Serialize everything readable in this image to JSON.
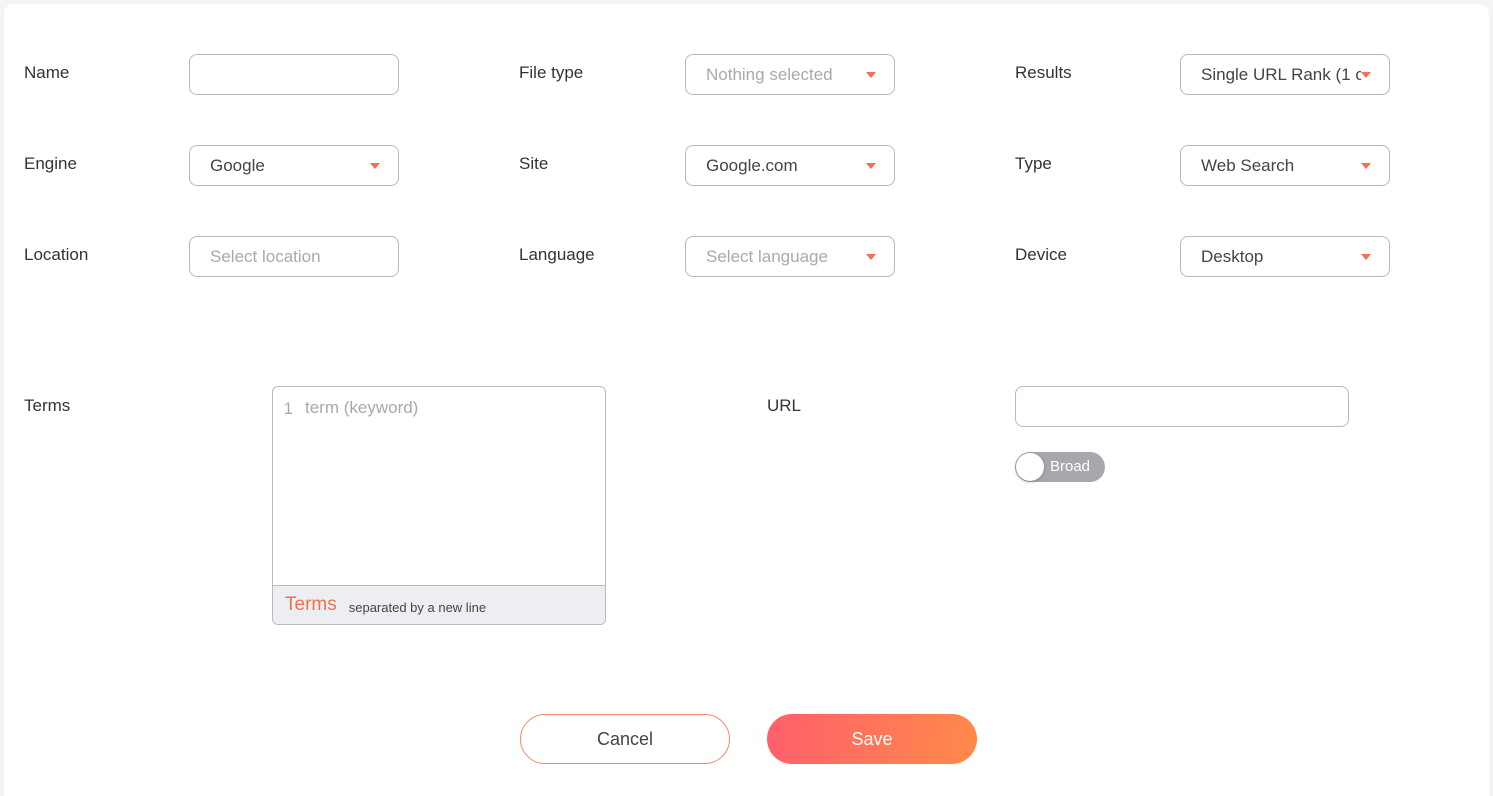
{
  "form": {
    "name": {
      "label": "Name",
      "value": ""
    },
    "file_type": {
      "label": "File type",
      "value": "Nothing selected"
    },
    "results": {
      "label": "Results",
      "value": "Single URL Rank (1 c"
    },
    "engine": {
      "label": "Engine",
      "value": "Google"
    },
    "site": {
      "label": "Site",
      "value": "Google.com"
    },
    "type": {
      "label": "Type",
      "value": "Web Search"
    },
    "location": {
      "label": "Location",
      "placeholder": "Select location"
    },
    "language": {
      "label": "Language",
      "value": "Select language"
    },
    "device": {
      "label": "Device",
      "value": "Desktop"
    },
    "terms": {
      "label": "Terms",
      "line_number": "1",
      "placeholder": "term (keyword)",
      "footer_title": "Terms",
      "footer_hint": "separated by a new line"
    },
    "url": {
      "label": "URL",
      "value": ""
    },
    "broad_toggle": {
      "label": "Broad"
    }
  },
  "actions": {
    "cancel_label": "Cancel",
    "save_label": "Save"
  },
  "colors": {
    "accent": "#f2704d",
    "toggle_off": "#a7a8ae",
    "save_gradient_start": "#ff5f6d",
    "save_gradient_end": "#ff8a48"
  }
}
